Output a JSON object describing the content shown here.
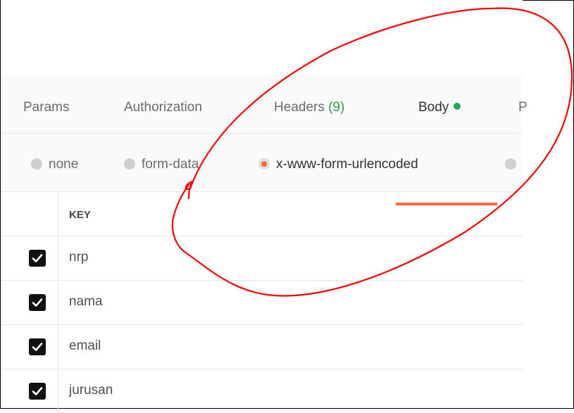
{
  "tabs": [
    {
      "label": "Params"
    },
    {
      "label": "Authorization"
    },
    {
      "label": "Headers ",
      "count": "(9)"
    },
    {
      "label": "Body"
    },
    {
      "label": "P"
    }
  ],
  "body_types": [
    {
      "label": "none"
    },
    {
      "label": "form-data"
    },
    {
      "label": "x-www-form-urlencoded"
    }
  ],
  "table": {
    "header_key": "KEY",
    "rows": [
      {
        "key": "nrp",
        "checked": true
      },
      {
        "key": "nama",
        "checked": true
      },
      {
        "key": "email",
        "checked": true
      },
      {
        "key": "jurusan",
        "checked": true
      }
    ]
  },
  "colors": {
    "accent": "#f26b3a",
    "status_dot": "#26a65b",
    "annotation": "#ff0000"
  }
}
